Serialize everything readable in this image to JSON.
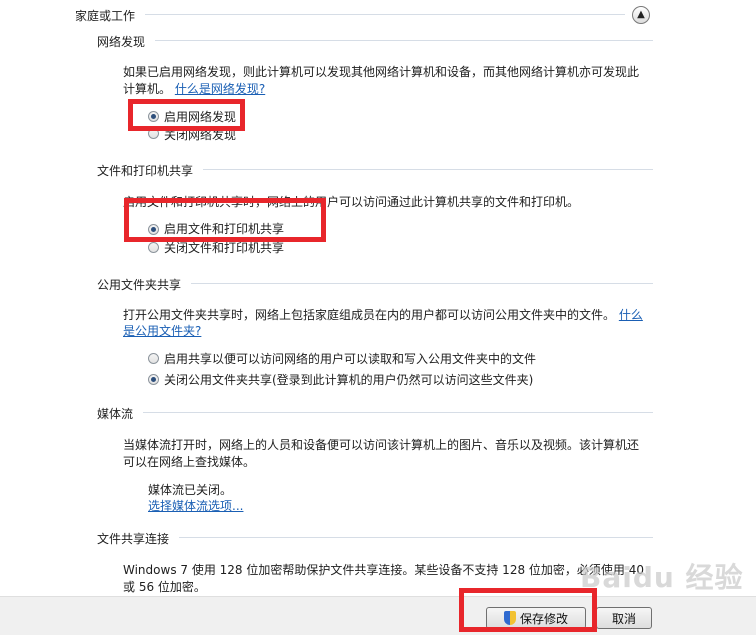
{
  "section_header": {
    "title": "家庭或工作",
    "collapse_icon": "chevron-up-icon"
  },
  "network_discovery": {
    "heading": "网络发现",
    "desc_line1": "如果已启用网络发现，则此计算机可以发现其他网络计算机和设备，而其他网络计算机亦可发现此",
    "desc_line2": "计算机。",
    "help_link": "什么是网络发现?",
    "option_on": "启用网络发现",
    "option_off": "关闭网络发现"
  },
  "file_printer": {
    "heading": "文件和打印机共享",
    "desc": "启用文件和打印机共享时，网络上的用户可以访问通过此计算机共享的文件和打印机。",
    "option_on": "启用文件和打印机共享",
    "option_off": "关闭文件和打印机共享"
  },
  "public_folder": {
    "heading": "公用文件夹共享",
    "desc_line1": "打开公用文件夹共享时，网络上包括家庭组成员在内的用户都可以访问公用文件夹中的文件。",
    "help_link_part1": "什么",
    "help_link_part2": "是公用文件夹?",
    "option_on": "启用共享以便可以访问网络的用户可以读取和写入公用文件夹中的文件",
    "option_off": "关闭公用文件夹共享(登录到此计算机的用户仍然可以访问这些文件夹)"
  },
  "media_streaming": {
    "heading": "媒体流",
    "desc_line1": "当媒体流打开时，网络上的人员和设备便可以访问该计算机上的图片、音乐以及视频。该计算机还",
    "desc_line2": "可以在网络上查找媒体。",
    "status": "媒体流已关闭。",
    "options_link": "选择媒体流选项..."
  },
  "file_sharing_conn": {
    "heading": "文件共享连接",
    "desc_line1": "Windows 7 使用 128 位加密帮助保护文件共享连接。某些设备不支持 128 位加密，必须使用 40",
    "desc_line2": "或 56 位加密。"
  },
  "buttons": {
    "save": "保存修改",
    "cancel": "取消"
  },
  "watermark": "Baidu 经验",
  "colors": {
    "highlight": "#e8262b",
    "link": "#1a5fb4"
  }
}
